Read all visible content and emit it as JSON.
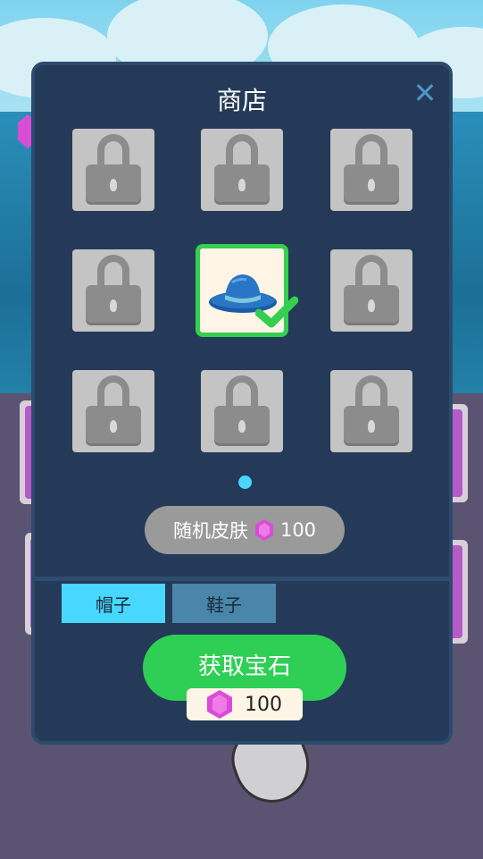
{
  "shop": {
    "title": "商店",
    "close_icon": "close-icon",
    "slots": [
      {
        "state": "locked",
        "icon": "lock-icon"
      },
      {
        "state": "locked",
        "icon": "lock-icon"
      },
      {
        "state": "locked",
        "icon": "lock-icon"
      },
      {
        "state": "locked",
        "icon": "lock-icon"
      },
      {
        "state": "selected",
        "icon": "blue-hat-icon",
        "badge": "checkmark-icon"
      },
      {
        "state": "locked",
        "icon": "lock-icon"
      },
      {
        "state": "locked",
        "icon": "lock-icon"
      },
      {
        "state": "locked",
        "icon": "lock-icon"
      },
      {
        "state": "locked",
        "icon": "lock-icon"
      }
    ],
    "page_indicator": {
      "current": 1,
      "total": 1
    },
    "random_skin": {
      "label": "随机皮肤",
      "price": "100",
      "icon": "gem-icon"
    },
    "tabs": [
      {
        "label": "帽子",
        "active": true
      },
      {
        "label": "鞋子",
        "active": false
      }
    ],
    "get_gems": {
      "label": "获取宝石",
      "amount": "100",
      "icon": "gem-icon"
    }
  },
  "colors": {
    "panel_bg": "#243a58",
    "accent_cyan": "#47d7ff",
    "accent_green": "#2fcf55",
    "gem_pink": "#d94dd6",
    "close_blue": "#4b97c8"
  }
}
